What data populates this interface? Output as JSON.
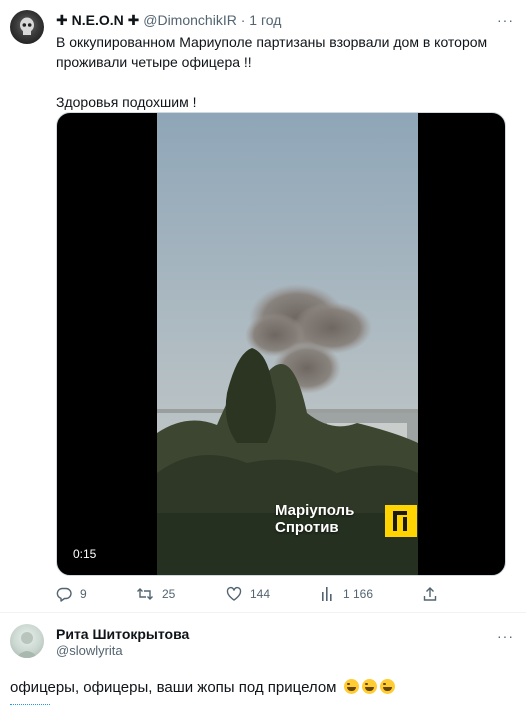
{
  "tweet": {
    "author_name": "✚ N.E.O.N ✚",
    "handle": "@DimonchikIR",
    "separator": "·",
    "time": "1 год",
    "more": "···",
    "text_line1": "В оккупированном Мариуполе партизаны взорвали дом в котором проживали четыре офицера !!",
    "text_line2": "Здоровья подохшим !",
    "media": {
      "watermark_line1": "Маріуполь",
      "watermark_line2": "Спротив",
      "duration": "0:15"
    },
    "actions": {
      "replies": "9",
      "retweets": "25",
      "likes": "144",
      "views": "1 166"
    },
    "colors": {
      "accent": "#1d9bf0",
      "muted": "#536471",
      "text": "#0f1419"
    }
  },
  "reply": {
    "author_name": "Рита Шитокрытова",
    "handle": "@slowlyrita",
    "more": "···",
    "text": "офицеры, офицеры, ваши жопы под прицелом",
    "emojis": [
      "laughing-emoji",
      "laughing-emoji",
      "laughing-emoji"
    ]
  }
}
